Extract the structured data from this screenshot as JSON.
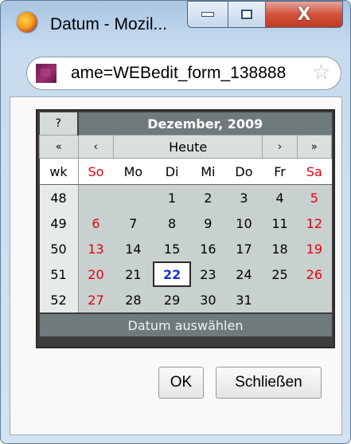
{
  "window": {
    "title": "Datum - Mozil...",
    "min_symbol": "–",
    "close_symbol": "X"
  },
  "urlbar": {
    "url": "ame=WEBedit_form_138888"
  },
  "calendar": {
    "help_label": "?",
    "month_title": "Dezember, 2009",
    "nav": {
      "prev_year": "«",
      "prev_month": "‹",
      "today": "Heute",
      "next_month": "›",
      "next_year": "»"
    },
    "week_header": "wk",
    "days": [
      "So",
      "Mo",
      "Di",
      "Mi",
      "Do",
      "Fr",
      "Sa"
    ],
    "weeks": [
      {
        "wk": "48",
        "days": [
          "",
          "",
          "1",
          "2",
          "3",
          "4",
          "5"
        ]
      },
      {
        "wk": "49",
        "days": [
          "6",
          "7",
          "8",
          "9",
          "10",
          "11",
          "12"
        ]
      },
      {
        "wk": "50",
        "days": [
          "13",
          "14",
          "15",
          "16",
          "17",
          "18",
          "19"
        ]
      },
      {
        "wk": "51",
        "days": [
          "20",
          "21",
          "22",
          "23",
          "24",
          "25",
          "26"
        ]
      },
      {
        "wk": "52",
        "days": [
          "27",
          "28",
          "29",
          "30",
          "31",
          "",
          ""
        ]
      }
    ],
    "selected_day": "22",
    "footer": "Datum auswählen",
    "colors": {
      "weekend": "#e8000b",
      "today": "#1733d8",
      "header_bg": "#6f7a7d"
    }
  },
  "buttons": {
    "ok": "OK",
    "close": "Schließen"
  }
}
